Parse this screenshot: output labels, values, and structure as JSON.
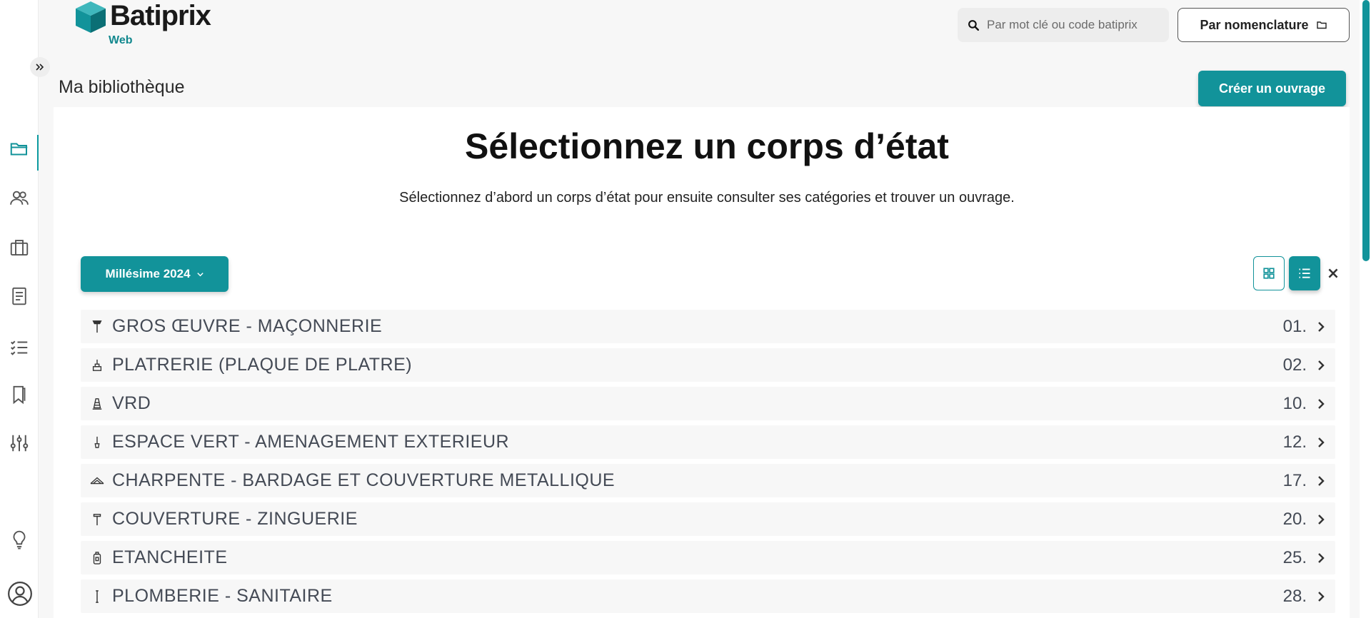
{
  "header": {
    "logo_text": "Batiprix",
    "logo_sub": "Web",
    "search_placeholder": "Par mot clé ou code batiprix",
    "nomenclature_label": "Par nomenclature"
  },
  "page": {
    "title": "Ma bibliothèque",
    "create_label": "Créer un ouvrage",
    "heading": "Sélectionnez un corps d’état",
    "subtext": "Sélectionnez d’abord un corps d’état pour ensuite consulter ses catégories et trouver un ouvrage.",
    "millesime_label": "Millésime 2024"
  },
  "colors": {
    "accent": "#12939a",
    "text": "#444a55"
  },
  "sidebar": {
    "items": [
      {
        "icon": "folder-icon",
        "active": true
      },
      {
        "icon": "users-icon",
        "active": false
      },
      {
        "icon": "briefcase-icon",
        "active": false
      },
      {
        "icon": "document-icon",
        "active": false
      },
      {
        "icon": "checklist-icon",
        "active": false
      },
      {
        "icon": "bookmarks-icon",
        "active": false
      },
      {
        "icon": "sliders-icon",
        "active": false
      }
    ],
    "bottom": [
      {
        "icon": "lightbulb-icon"
      },
      {
        "icon": "account-icon"
      }
    ]
  },
  "trades": [
    {
      "label": "GROS ŒUVRE - MAÇONNERIE",
      "code": "01.",
      "icon": "trowel-icon"
    },
    {
      "label": "PLATRERIE (PLAQUE DE PLATRE)",
      "code": "02.",
      "icon": "plaster-icon"
    },
    {
      "label": "VRD",
      "code": "10.",
      "icon": "cone-icon"
    },
    {
      "label": "ESPACE VERT - AMENAGEMENT EXTERIEUR",
      "code": "12.",
      "icon": "shovel-icon"
    },
    {
      "label": "CHARPENTE - BARDAGE ET COUVERTURE METALLIQUE",
      "code": "17.",
      "icon": "roof-icon"
    },
    {
      "label": "COUVERTURE - ZINGUERIE",
      "code": "20.",
      "icon": "hammer-icon"
    },
    {
      "label": "ETANCHEITE",
      "code": "25.",
      "icon": "bottle-icon"
    },
    {
      "label": "PLOMBERIE - SANITAIRE",
      "code": "28.",
      "icon": "pipe-icon"
    }
  ]
}
